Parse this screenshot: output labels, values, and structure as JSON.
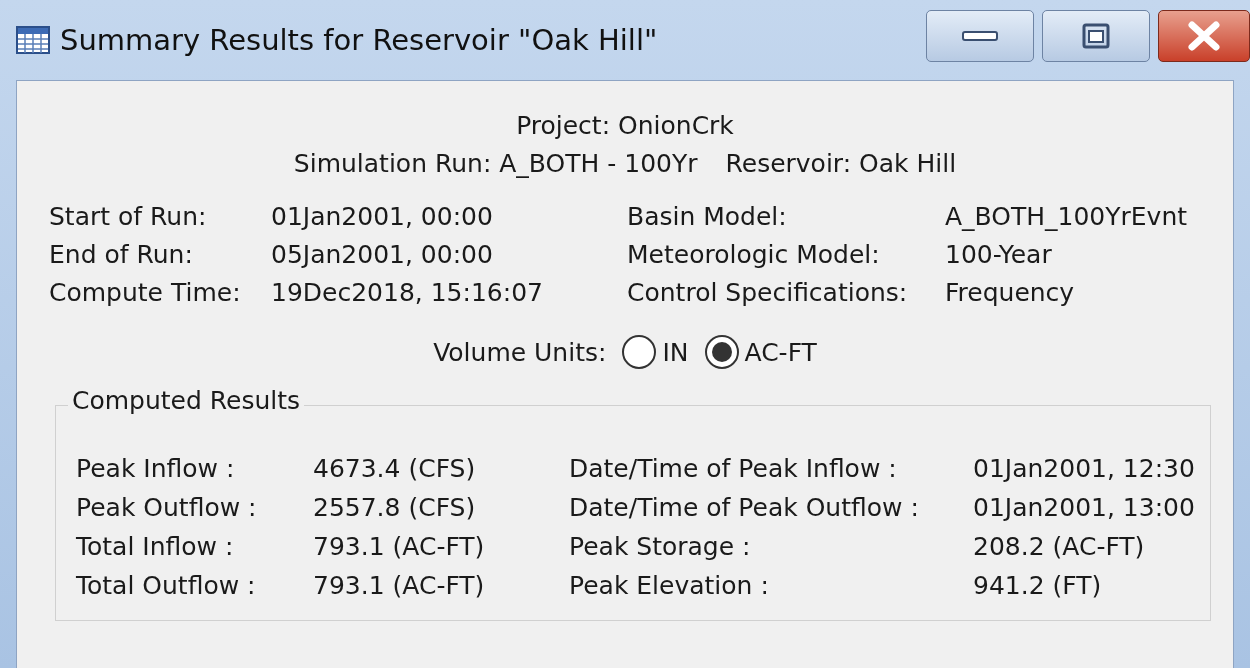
{
  "window": {
    "title": "Summary Results for Reservoir \"Oak Hill\""
  },
  "header": {
    "project": "Project: OnionCrk",
    "simulation_run": "Simulation Run: A_BOTH - 100Yr",
    "reservoir": "Reservoir: Oak Hill"
  },
  "run_info": [
    {
      "label": "Start of Run:",
      "value": "01Jan2001, 00:00",
      "label_2": "Basin Model:",
      "value_2": "A_BOTH_100YrEvnt"
    },
    {
      "label": "End of Run:",
      "value": "05Jan2001, 00:00",
      "label_2": "Meteorologic Model:",
      "value_2": "100-Year"
    },
    {
      "label": "Compute Time:",
      "value": "19Dec2018, 15:16:07",
      "label_2": "Control Specifications:",
      "value_2": "Frequency"
    }
  ],
  "volume_units": {
    "label": "Volume Units:",
    "options": [
      {
        "label": "IN",
        "selected": false
      },
      {
        "label": "AC-FT",
        "selected": true
      }
    ]
  },
  "computed_results": {
    "title": "Computed Results",
    "rows": [
      {
        "label": "Peak Inflow :",
        "value": "4673.4 (CFS)",
        "label_2": "Date/Time of Peak Inflow :",
        "value_2": "01Jan2001, 12:30"
      },
      {
        "label": "Peak Outflow :",
        "value": "2557.8 (CFS)",
        "label_2": "Date/Time of Peak Outflow :",
        "value_2": "01Jan2001, 13:00"
      },
      {
        "label": "Total Inflow :",
        "value": "793.1 (AC-FT)",
        "label_2": "Peak Storage :",
        "value_2": "208.2 (AC-FT)"
      },
      {
        "label": "Total Outflow :",
        "value": "793.1 (AC-FT)",
        "label_2": "Peak Elevation :",
        "value_2": "941.2 (FT)"
      }
    ]
  }
}
